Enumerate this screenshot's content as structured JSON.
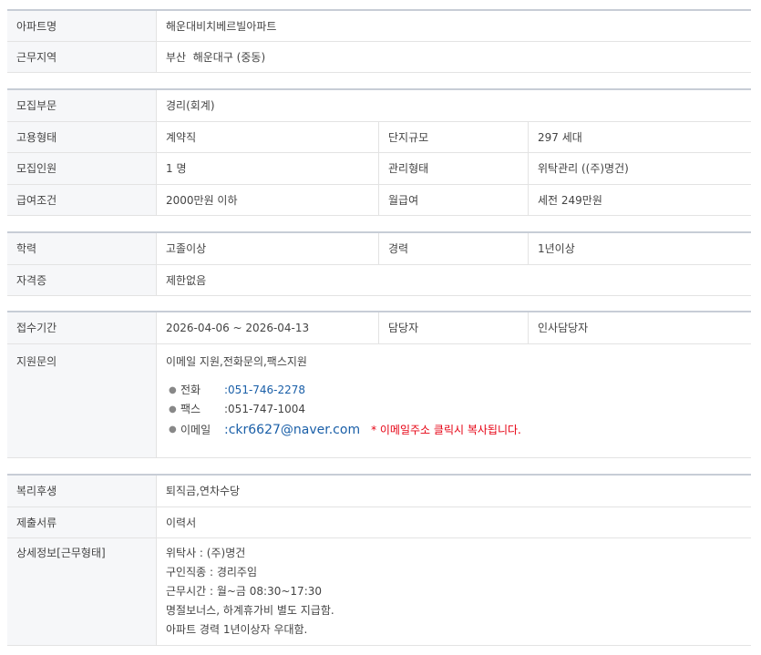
{
  "basic": {
    "apt_name_label": "아파트명",
    "apt_name_value": "해운대비치베르빌아파트",
    "region_label": "근무지역",
    "region_value": "부산  해운대구 (중동)"
  },
  "recruit": {
    "dept_label": "모집부문",
    "dept_value": "경리(회계)",
    "employment_label": "고용형태",
    "employment_value": "계약직",
    "complex_label": "단지규모",
    "complex_value": "297 세대",
    "headcount_label": "모집인원",
    "headcount_value": "1 명",
    "mgmt_label": "관리형태",
    "mgmt_value": "위탁관리 ((주)명건)",
    "salary_label": "급여조건",
    "salary_value": "2000만원 이하",
    "monthly_label": "월급여",
    "monthly_value": "세전 249만원"
  },
  "qualify": {
    "edu_label": "학력",
    "edu_value": "고졸이상",
    "exp_label": "경력",
    "exp_value": "1년이상",
    "cert_label": "자격증",
    "cert_value": "제한없음"
  },
  "apply": {
    "period_label": "접수기간",
    "period_value": "2026-04-06 ~ 2026-04-13",
    "manager_label": "담당자",
    "manager_value": "인사담당자",
    "inquiry_label": "지원문의",
    "inquiry_value": "이메일 지원,전화문의,팩스지원",
    "phone_label": "전화",
    "phone_value": ":051-746-2278",
    "fax_label": "팩스",
    "fax_value": ":051-747-1004",
    "email_label": "이메일",
    "email_value": ":ckr6627@naver.com",
    "email_notice": "* 이메일주소 클릭시 복사됩니다."
  },
  "extra": {
    "welfare_label": "복리후생",
    "welfare_value": "퇴직금,연차수당",
    "docs_label": "제출서류",
    "docs_value": "이력서",
    "detail_label": "상세정보[근무형태]",
    "detail_lines": [
      "위탁사 : (주)명건",
      "구인직종 : 경리주임",
      "근무시간 : 월~금 08:30~17:30",
      "명절보너스, 하계휴가비 별도 지급함.",
      "아파트 경력 1년이상자 우대함."
    ]
  }
}
